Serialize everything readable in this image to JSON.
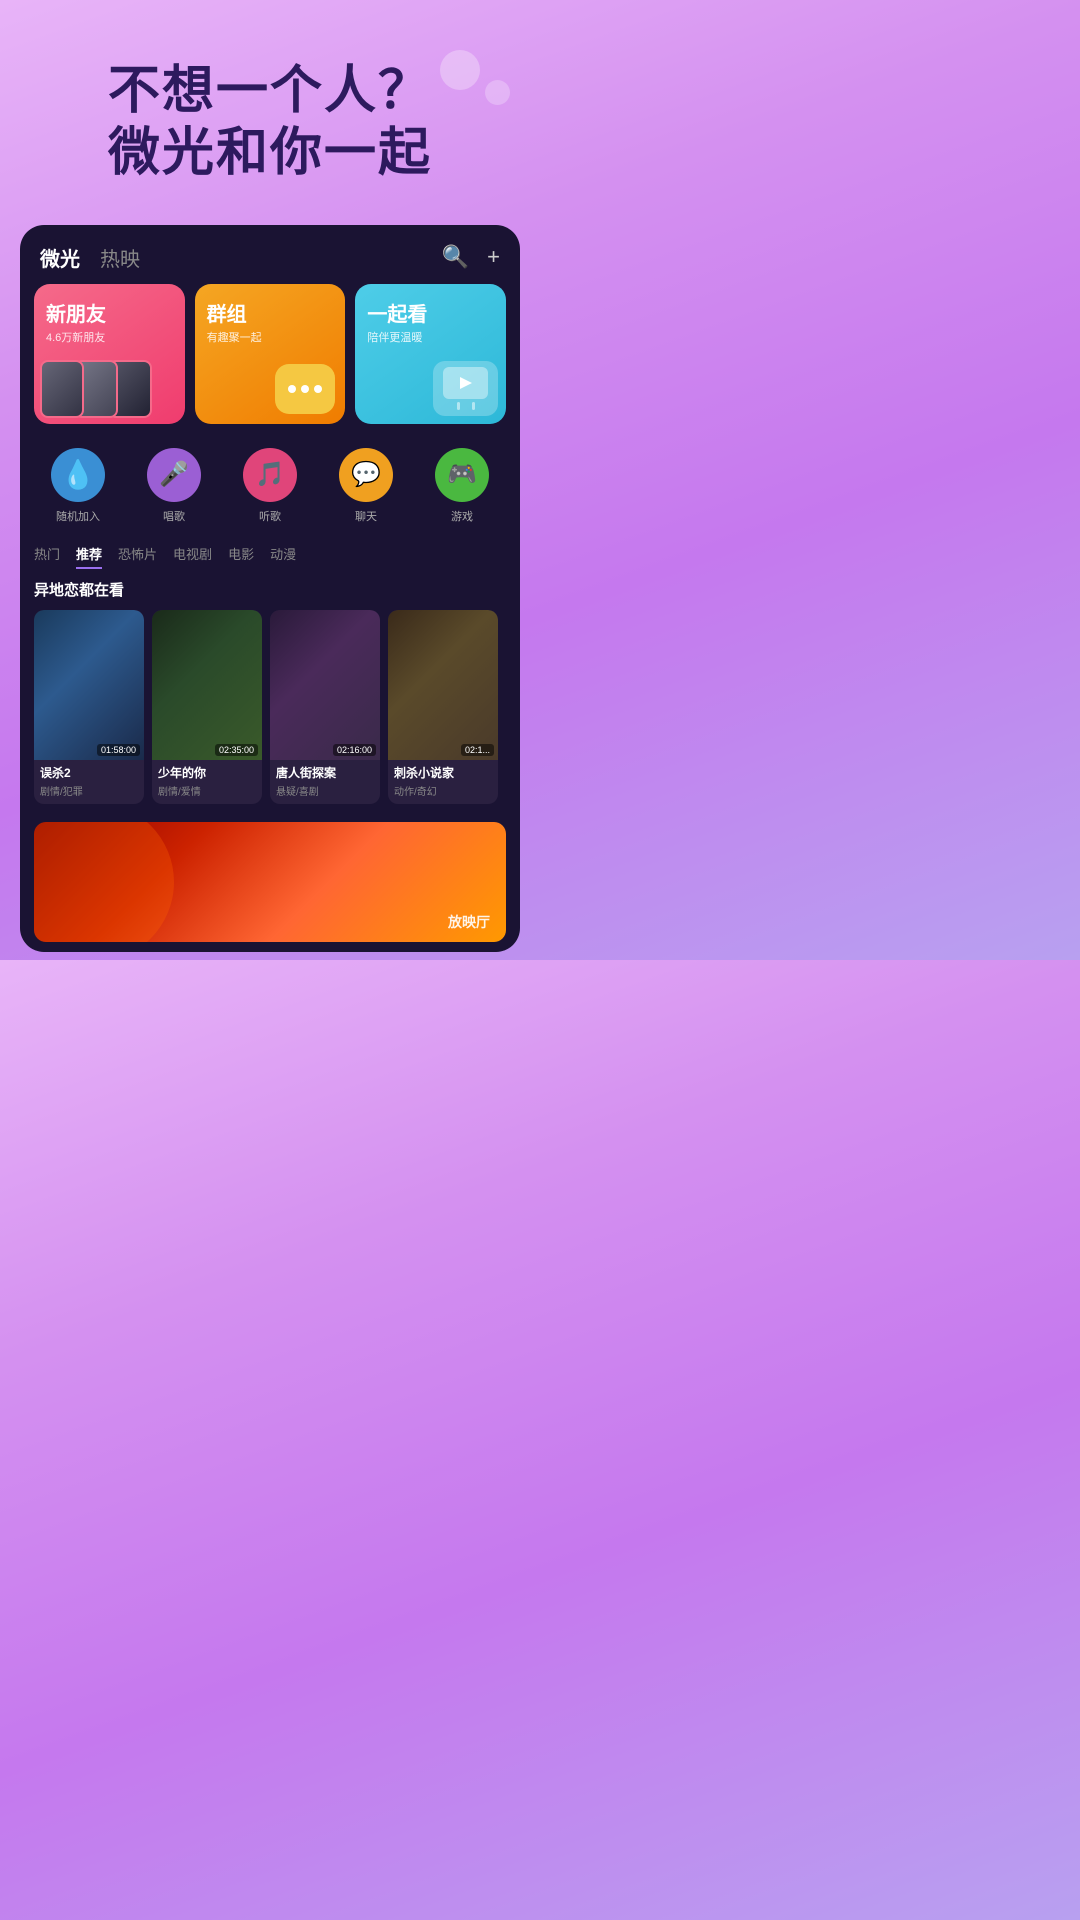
{
  "hero": {
    "line1": "不想一个人？",
    "line2": "微光和你一起"
  },
  "nav": {
    "tab1": "微光",
    "tab2": "热映",
    "search_icon": "🔍",
    "add_icon": "+"
  },
  "feature_cards": [
    {
      "id": "new_friends",
      "title": "新朋友",
      "sub": "4.6万新朋友",
      "color": "pink"
    },
    {
      "id": "groups",
      "title": "群组",
      "sub": "有趣聚一起",
      "color": "orange"
    },
    {
      "id": "watch_together",
      "title": "一起看",
      "sub": "陪伴更温暖",
      "color": "cyan"
    }
  ],
  "functions": [
    {
      "id": "random_join",
      "label": "随机加入",
      "icon": "💧",
      "bg": "#3a8fd4"
    },
    {
      "id": "sing",
      "label": "唱歌",
      "icon": "🎤",
      "bg": "#9b5fd4"
    },
    {
      "id": "listen",
      "label": "听歌",
      "icon": "🎵",
      "bg": "#e0457a"
    },
    {
      "id": "chat",
      "label": "聊天",
      "icon": "💬",
      "bg": "#f0a020"
    },
    {
      "id": "game",
      "label": "游戏",
      "icon": "🎮",
      "bg": "#4ab840"
    }
  ],
  "categories": [
    {
      "id": "hot",
      "label": "热门",
      "active": false
    },
    {
      "id": "recommend",
      "label": "推荐",
      "active": true
    },
    {
      "id": "horror",
      "label": "恐怖片",
      "active": false
    },
    {
      "id": "tv",
      "label": "电视剧",
      "active": false
    },
    {
      "id": "movie",
      "label": "电影",
      "active": false
    },
    {
      "id": "anime",
      "label": "动漫",
      "active": false
    }
  ],
  "section_title": "异地恋都在看",
  "movies": [
    {
      "id": "m1",
      "title": "误杀2",
      "genre": "剧情/犯罪",
      "duration": "01:58:00"
    },
    {
      "id": "m2",
      "title": "少年的你",
      "genre": "剧情/爱情",
      "duration": "02:35:00"
    },
    {
      "id": "m3",
      "title": "唐人街探案",
      "genre": "悬疑/喜剧",
      "duration": "02:16:00"
    },
    {
      "id": "m4",
      "title": "刺杀小说家",
      "genre": "动作/奇幻",
      "duration": "02:1..."
    }
  ],
  "bottom_preview_label": "放映厅"
}
